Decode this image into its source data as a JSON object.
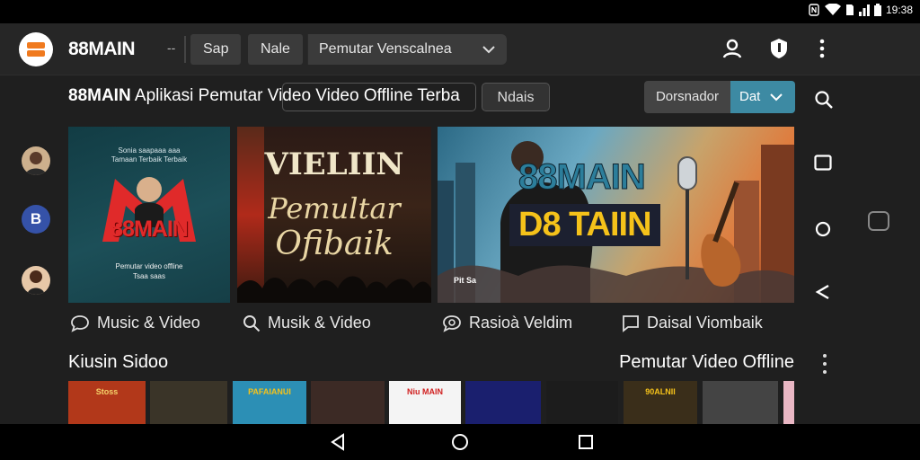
{
  "status_bar": {
    "time": "19:38",
    "icons": [
      "nfc-icon",
      "wifi-icon",
      "sim-icon",
      "signal-icon",
      "battery-icon"
    ]
  },
  "top_bar": {
    "app_name": "88MAIN",
    "separator": "--",
    "chips": [
      "Sap",
      "Nale"
    ],
    "dropdown_value": "Pemutar Venscalnea",
    "icons": [
      "account-icon",
      "shield-icon",
      "more-vert-icon"
    ]
  },
  "title_row": {
    "title_brand": "88MAIN",
    "title_text": "Aplikasi Pemutar Video Video Offline Terba",
    "tag_button": "Ndais",
    "sort_label": "Dorsnador",
    "sort_value": "Dat"
  },
  "featured": [
    {
      "header_lines": [
        "Sonia saapaaa aaa",
        "Tamaan Terbaik Terbaik"
      ],
      "brand": "88MAIN",
      "sub_lines": [
        "Pemutar video offline",
        "Tsaa saas"
      ]
    },
    {
      "lines": [
        "VIELIIN",
        "Pemultar",
        "Ofibaik"
      ]
    },
    {
      "line1": "88MAIN",
      "line2": "D8 TAIIN",
      "small": "Pit Sa"
    }
  ],
  "categories": [
    {
      "label": "Music & Video",
      "icon": "chat-bubble-icon"
    },
    {
      "label": "Musik & Video",
      "icon": "search-icon"
    },
    {
      "label": "Rasioà Veldim",
      "icon": "chat-search-icon"
    },
    {
      "label": "Daisal Viombaik",
      "icon": "message-square-icon"
    }
  ],
  "section": {
    "left_title": "Kiusin Sidoo",
    "right_title": "Pemutar Video Offline"
  },
  "thumbnails": [
    {
      "caption": "Stoss",
      "bg": "#b2381a"
    },
    {
      "caption": "",
      "bg": "#3a3428"
    },
    {
      "caption": "PAFAIANUI",
      "bg": "#2c8fb5"
    },
    {
      "caption": "",
      "bg": "#3c2a25"
    },
    {
      "caption": "Niu MAIN",
      "bg": "#f4f4f4"
    },
    {
      "caption": "",
      "bg": "#1a1f6e"
    },
    {
      "caption": "",
      "bg": "#1c1c1c"
    },
    {
      "caption": "90ALNII",
      "bg": "#3a2e1a"
    },
    {
      "caption": "",
      "bg": "#444444"
    },
    {
      "caption": "",
      "bg": "#e9b7c4"
    }
  ],
  "right_rail": [
    "search-icon",
    "square-icon",
    "circle-icon",
    "back-icon"
  ],
  "nav_bar": [
    "nav-back-icon",
    "nav-home-icon",
    "nav-recents-icon"
  ],
  "colors": {
    "accent": "#3d8aa3",
    "brand_orange": "#f07a1e",
    "brand_red": "#e02a2a",
    "background": "#1f1f1f"
  }
}
